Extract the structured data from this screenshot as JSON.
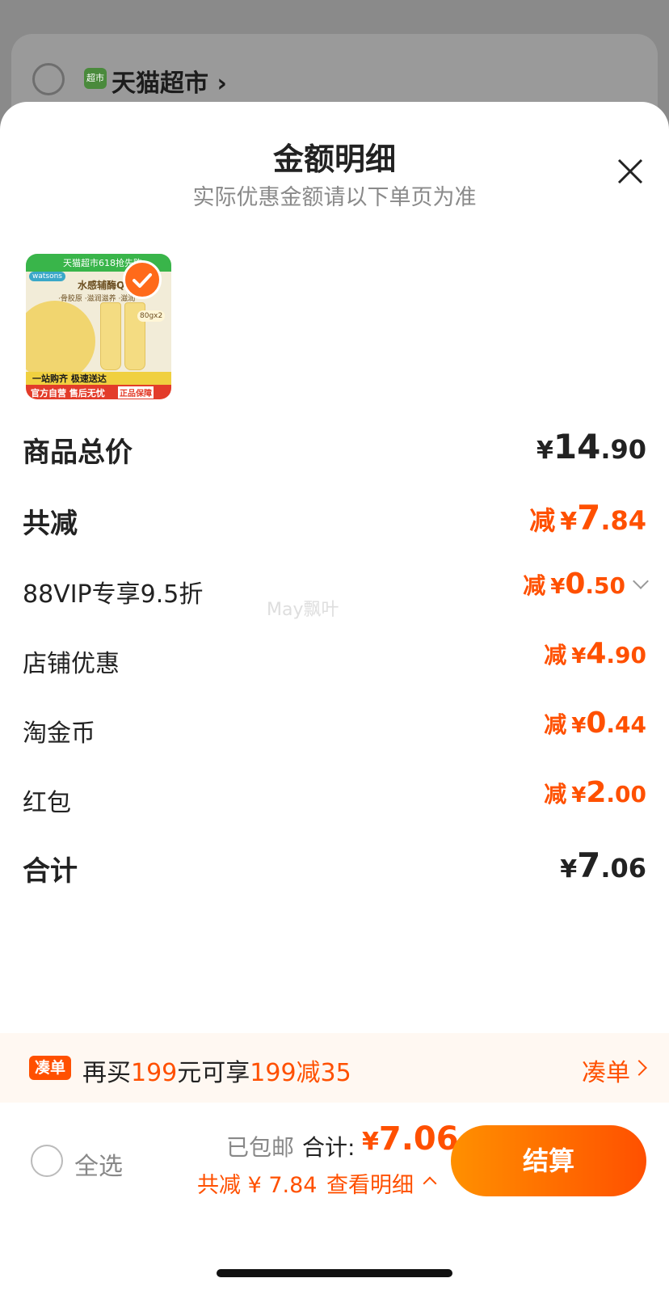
{
  "background": {
    "store_name": "天猫超市",
    "store_icon_text": "超市"
  },
  "sheet": {
    "title": "金额明细",
    "subtitle": "实际优惠金额请以下单页为准"
  },
  "product_image": {
    "top_banner": "天猫超市618抢先购",
    "brand": "watsons",
    "name": "水感辅酶Q10",
    "subtitle": "·骨胶原 ·滋润滋养 ·滋润",
    "size": "80gx2",
    "banner1": "一站购齐 极速送达",
    "banner2": "官方自营 售后无忧",
    "guarantee": "正品保障"
  },
  "rows": [
    {
      "label": "商品总价",
      "prefix": "",
      "currency": "¥",
      "int": "14",
      "dec": ".90",
      "style": "total",
      "color": "black"
    },
    {
      "label": "共减",
      "prefix": "减",
      "currency": "¥",
      "int": "7",
      "dec": ".84",
      "style": "total",
      "color": "orange"
    },
    {
      "label": "88VIP专享9.5折",
      "prefix": "减",
      "currency": "¥",
      "int": "0",
      "dec": ".50",
      "style": "item",
      "color": "orange",
      "expandable": true
    },
    {
      "label": "店铺优惠",
      "prefix": "减",
      "currency": "¥",
      "int": "4",
      "dec": ".90",
      "style": "item",
      "color": "orange"
    },
    {
      "label": "淘金币",
      "prefix": "减",
      "currency": "¥",
      "int": "0",
      "dec": ".44",
      "style": "item",
      "color": "orange"
    },
    {
      "label": "红包",
      "prefix": "减",
      "currency": "¥",
      "int": "2",
      "dec": ".00",
      "style": "item",
      "color": "orange"
    },
    {
      "label": "合计",
      "prefix": "",
      "currency": "¥",
      "int": "7",
      "dec": ".06",
      "style": "total",
      "color": "black"
    }
  ],
  "watermark": "May飘叶",
  "promo": {
    "tag": "凑单",
    "text_1": "再买",
    "amount": "199",
    "text_2": "元可享",
    "deal": "199减35",
    "link": "凑单"
  },
  "bottom_bar": {
    "select_all": "全选",
    "shipping": "已包邮",
    "total_label": "合计:",
    "total_currency": "¥",
    "total_value": "7.06",
    "discount": "共减 ¥ 7.84",
    "view_details": "查看明细",
    "checkout": "结算"
  },
  "colors": {
    "accent": "#ff5000",
    "checkout_gradient_start": "#ff9000",
    "checkout_gradient_end": "#ff5000"
  }
}
